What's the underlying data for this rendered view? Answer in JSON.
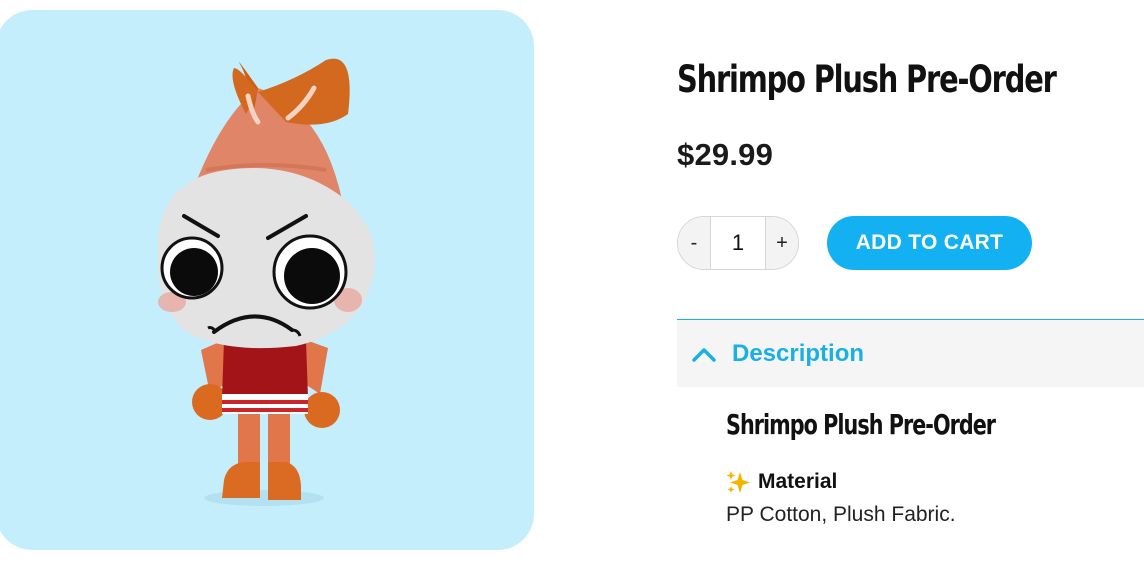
{
  "product": {
    "title": "Shrimpo Plush Pre-Order",
    "price": "$29.99",
    "image_icon": "shrimpo-plush-image"
  },
  "purchase": {
    "decrement_label": "-",
    "quantity": "1",
    "increment_label": "+",
    "add_to_cart_label": "ADD TO CART"
  },
  "accordion": {
    "header_label": "Description",
    "expanded": true,
    "chevron_icon": "chevron-up-icon"
  },
  "description": {
    "title": "Shrimpo Plush Pre-Order",
    "material_icon": "sparkles-icon",
    "material_heading": "Material",
    "material_text": "PP Cotton, Plush Fabric."
  },
  "colors": {
    "accent": "#13b1f2",
    "image_background": "#c5eefc",
    "accordion_background": "#f5f5f5"
  }
}
